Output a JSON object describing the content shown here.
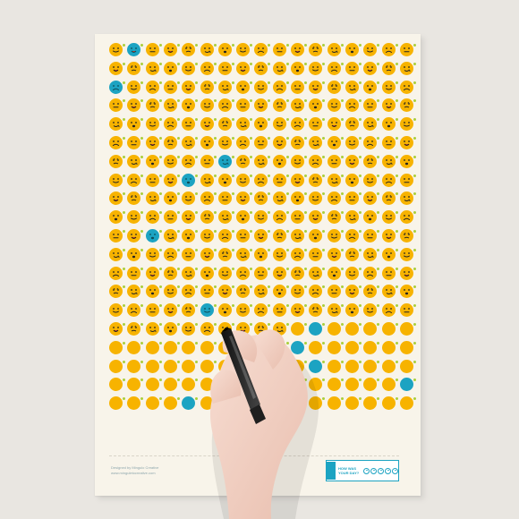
{
  "poster": {
    "rows": 20,
    "cols": 17,
    "filled_days": 265,
    "blue_cells": [
      1,
      34,
      108,
      123,
      172,
      243,
      266,
      282,
      300,
      322,
      327
    ]
  },
  "colors": {
    "background": "#e9e6e1",
    "paper": "#f8f4ea",
    "yellow": "#f7b300",
    "blue": "#1ca3c2",
    "green": "#aacf3a"
  },
  "footer": {
    "credit_line": "Designed by Mingulo Creative",
    "url_line": "www.minguletocreative.com",
    "legend_title": "HOW WAS YOUR DAY?"
  }
}
